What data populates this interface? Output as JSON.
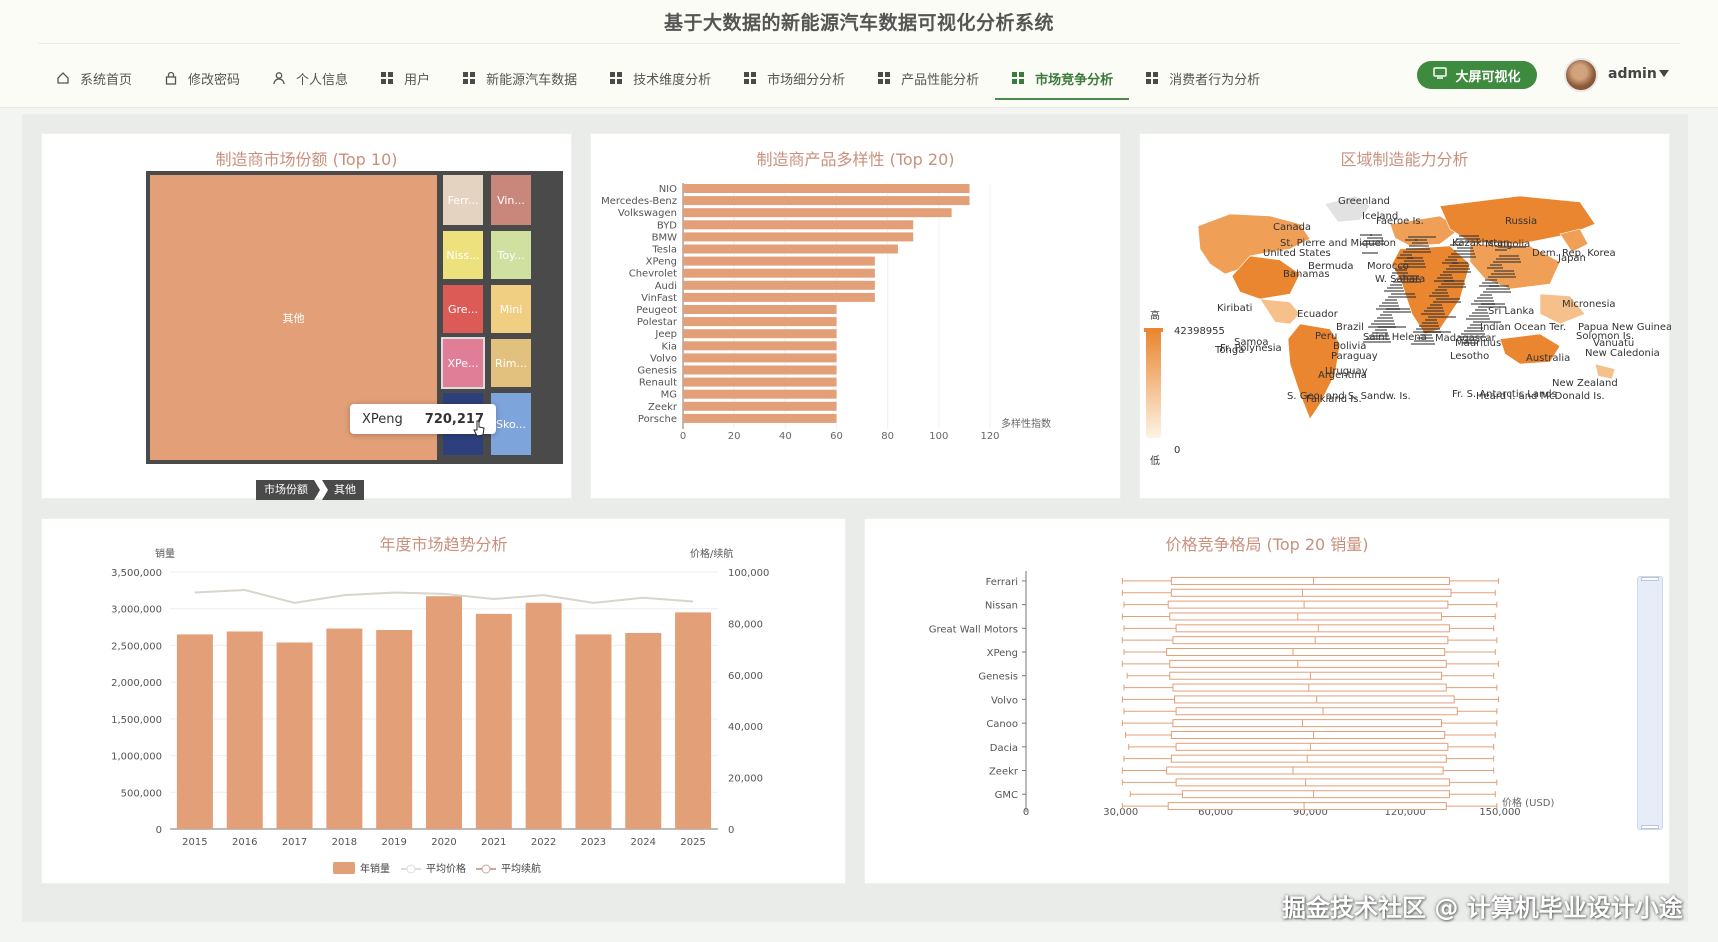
{
  "header": {
    "title": "基于大数据的新能源汽车数据可视化分析系统",
    "nav": [
      {
        "label": "系统首页",
        "icon": "home-icon"
      },
      {
        "label": "修改密码",
        "icon": "lock-icon"
      },
      {
        "label": "个人信息",
        "icon": "user-icon"
      },
      {
        "label": "用户",
        "icon": "grid-icon"
      },
      {
        "label": "新能源汽车数据",
        "icon": "grid-icon"
      },
      {
        "label": "技术维度分析",
        "icon": "grid-icon"
      },
      {
        "label": "市场细分分析",
        "icon": "grid-icon"
      },
      {
        "label": "产品性能分析",
        "icon": "grid-icon"
      },
      {
        "label": "市场竞争分析",
        "icon": "grid-icon",
        "active": true
      },
      {
        "label": "消费者行为分析",
        "icon": "grid-icon"
      }
    ],
    "bigscreen_label": "大屏可视化",
    "username": "admin"
  },
  "panels": {
    "treemap": {
      "title": "制造商市场份额 (Top 10)",
      "tooltip": {
        "name": "XPeng",
        "value": "720,217"
      },
      "breadcrumb": [
        "市场份额",
        "其他"
      ]
    },
    "diversity": {
      "title": "制造商产品多样性 (Top 20)"
    },
    "map": {
      "title": "区域制造能力分析"
    },
    "trend": {
      "title": "年度市场趋势分析"
    },
    "boxplot": {
      "title": "价格竞争格局 (Top 20 销量)"
    }
  },
  "watermark": "掘金技术社区 @ 计算机毕业设计小途",
  "chart_data": [
    {
      "type": "treemap",
      "title": "制造商市场份额 (Top 10)",
      "tiles": [
        {
          "label": "其他",
          "color": "#e29f78"
        },
        {
          "label": "Ferr...",
          "color": "#e3d3c0"
        },
        {
          "label": "Vin...",
          "color": "#c9877b"
        },
        {
          "label": "Niss...",
          "color": "#ede17e"
        },
        {
          "label": "Toy...",
          "color": "#cfe0a0"
        },
        {
          "label": "Gre...",
          "color": "#dd5b57"
        },
        {
          "label": "Mini",
          "color": "#f1cf82"
        },
        {
          "label": "XPe...",
          "color": "#e07e97"
        },
        {
          "label": "Rim...",
          "color": "#e2c07e"
        },
        {
          "label": "Gen...",
          "color": "#2d3f7c"
        },
        {
          "label": "Sko...",
          "color": "#7ea4dc"
        }
      ]
    },
    {
      "type": "bar",
      "title": "制造商产品多样性 (Top 20)",
      "orientation": "horizontal",
      "categories": [
        "NIO",
        "Mercedes-Benz",
        "Volkswagen",
        "BYD",
        "BMW",
        "Tesla",
        "XPeng",
        "Chevrolet",
        "Audi",
        "VinFast",
        "Peugeot",
        "Polestar",
        "Jeep",
        "Kia",
        "Volvo",
        "Genesis",
        "Renault",
        "MG",
        "Zeekr",
        "Porsche"
      ],
      "values": [
        112,
        112,
        105,
        90,
        90,
        84,
        75,
        75,
        75,
        75,
        60,
        60,
        60,
        60,
        60,
        60,
        60,
        60,
        60,
        60
      ],
      "xlabel": "多样性指数",
      "xticks": [
        "0",
        "20",
        "40",
        "60",
        "80",
        "100",
        "120"
      ],
      "xlim": [
        0,
        120
      ],
      "color": "#e29f78"
    },
    {
      "type": "map",
      "title": "区域制造能力分析",
      "labels": [
        "Greenland",
        "Iceland",
        "Faeroe Is.",
        "Russia",
        "Canada",
        "United States",
        "St. Pierre and Miquelon",
        "Kazakhstan",
        "Mongolia",
        "Dem. Rep. Korea",
        "Japan",
        "Bermuda",
        "Bahamas",
        "Morocco",
        "W. Sahara",
        "Sri Lanka",
        "Micronesia",
        "Ecuador",
        "Peru",
        "Brazil",
        "Bolivia",
        "Paraguay",
        "Uruguay",
        "Argentina",
        "Saint Helena",
        "Madagascar",
        "Mauritius",
        "Lesotho",
        "Indian Ocean Ter.",
        "Papua New Guinea",
        "Solomon Is.",
        "Vanuatu",
        "New Caledonia",
        "Australia",
        "New Zealand",
        "Kiribati",
        "Samoa",
        "Tonga",
        "Fr. Polynesia",
        "Falkland Is.",
        "S. Geo. and S. Sandw. Is.",
        "Fr. S. Antarctic Lands",
        "Heard I. and McDonald Is."
      ],
      "visual_map": {
        "high_label": "高",
        "low_label": "低",
        "max": "42398955",
        "min": "0"
      }
    },
    {
      "type": "bar+line",
      "title": "年度市场趋势分析",
      "categories": [
        "2015",
        "2016",
        "2017",
        "2018",
        "2019",
        "2020",
        "2021",
        "2022",
        "2023",
        "2024",
        "2025"
      ],
      "series": [
        {
          "name": "年销量",
          "type": "bar",
          "axis": "left",
          "values": [
            2650000,
            2690000,
            2540000,
            2730000,
            2710000,
            3170000,
            2930000,
            3080000,
            2650000,
            2670000,
            2950000
          ]
        },
        {
          "name": "平均价格",
          "type": "line",
          "axis": "right",
          "values": [
            92000,
            93000,
            88000,
            91000,
            92000,
            91500,
            89500,
            91000,
            88000,
            90000,
            88500
          ]
        },
        {
          "name": "平均续航",
          "type": "line",
          "axis": "right",
          "values": []
        }
      ],
      "ylabel_left": "销量",
      "ylabel_right": "价格/续航",
      "yleft_ticks": [
        "0",
        "500,000",
        "1,000,000",
        "1,500,000",
        "2,000,000",
        "2,500,000",
        "3,000,000",
        "3,500,000"
      ],
      "yright_ticks": [
        "0",
        "20,000",
        "40,000",
        "60,000",
        "80,000",
        "100,000"
      ],
      "ylim_left": [
        0,
        3500000
      ],
      "ylim_right": [
        0,
        100000
      ],
      "bar_color": "#e29f78",
      "line_color": "#d9d4cc"
    },
    {
      "type": "boxplot",
      "title": "价格竞争格局 (Top 20 销量)",
      "orientation": "horizontal",
      "labeled_categories": [
        "Ferrari",
        "Nissan",
        "Great Wall Motors",
        "XPeng",
        "Genesis",
        "Volvo",
        "Canoo",
        "Dacia",
        "Zeekr",
        "GMC"
      ],
      "boxes": [
        [
          30500,
          46000,
          91000,
          134000,
          149500
        ],
        [
          30500,
          46000,
          87500,
          134500,
          148500
        ],
        [
          31000,
          45000,
          88000,
          133500,
          149000
        ],
        [
          30500,
          45500,
          86000,
          131500,
          148500
        ],
        [
          31000,
          47500,
          92500,
          134000,
          148000
        ],
        [
          30500,
          46500,
          91500,
          133500,
          149000
        ],
        [
          31000,
          44500,
          84500,
          132500,
          148500
        ],
        [
          30500,
          45500,
          86000,
          133000,
          149500
        ],
        [
          32000,
          45500,
          90000,
          131500,
          148000
        ],
        [
          31000,
          46500,
          89500,
          133000,
          149000
        ],
        [
          30500,
          47000,
          92000,
          135500,
          149500
        ],
        [
          31000,
          47500,
          94000,
          136500,
          149000
        ],
        [
          30500,
          46500,
          87500,
          131500,
          149000
        ],
        [
          31500,
          46000,
          91000,
          132500,
          148500
        ],
        [
          32500,
          47500,
          90000,
          133500,
          148000
        ],
        [
          31000,
          46000,
          89000,
          133000,
          148000
        ],
        [
          30500,
          44500,
          84500,
          132000,
          148000
        ],
        [
          30500,
          47500,
          88500,
          134000,
          149000
        ],
        [
          33000,
          49500,
          91000,
          134000,
          148500
        ],
        [
          30500,
          45000,
          88000,
          133000,
          149000
        ]
      ],
      "xlabel": "价格 (USD)",
      "xticks": [
        "0",
        "30,000",
        "60,000",
        "90,000",
        "120,000",
        "150,000"
      ],
      "xlim": [
        0,
        150000
      ],
      "color": "#e29f78"
    }
  ]
}
